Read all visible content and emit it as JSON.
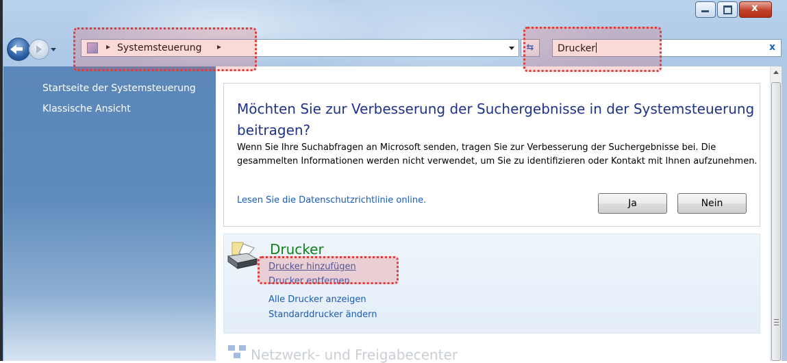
{
  "window": {
    "caption_buttons": [
      "minimize",
      "maximize",
      "close"
    ]
  },
  "address_bar": {
    "location": "Systemsteuerung",
    "separator": "▸"
  },
  "search": {
    "value": "Drucker",
    "clear_glyph": "x"
  },
  "sidebar": {
    "items": [
      {
        "label": "Startseite der Systemsteuerung"
      },
      {
        "label": "Klassische Ansicht"
      }
    ]
  },
  "promo": {
    "title": "Möchten Sie zur Verbesserung der Suchergebnisse in der Systemsteuerung beitragen?",
    "body": "Wenn Sie Ihre Suchabfragen an Microsoft senden, tragen Sie zur Verbesserung der Suchergebnisse bei. Die gesammelten Informationen werden nicht verwendet, um Sie zu identifizieren oder Kontakt mit Ihnen aufzunehmen.",
    "privacy_link": "Lesen Sie die Datenschutzrichtlinie online.",
    "yes_label": "Ja",
    "no_label": "Nein"
  },
  "results": {
    "printer_group": {
      "title": "Drucker",
      "tasks": [
        {
          "label": "Drucker hinzufügen"
        },
        {
          "label": "Drucker entfernen"
        },
        {
          "label": "Alle Drucker anzeigen"
        },
        {
          "label": "Standarddrucker ändern"
        }
      ]
    },
    "network_group": {
      "title": "Netzwerk- und Freigabecenter"
    }
  },
  "colors": {
    "title_blue": "#1e3287",
    "link_blue": "#1a5bb7",
    "group_green": "#0f7f1a",
    "highlight_red": "#e03b3b"
  }
}
